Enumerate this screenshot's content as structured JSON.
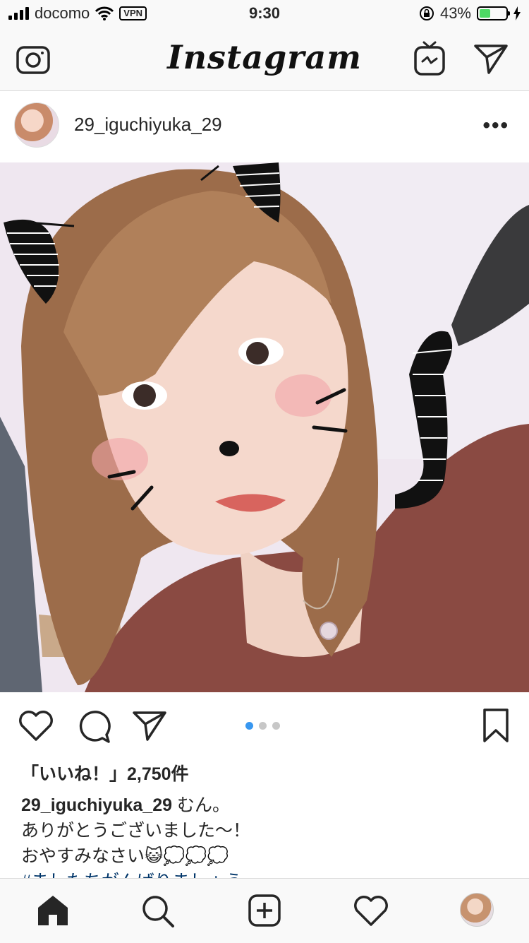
{
  "status_bar": {
    "carrier": "docomo",
    "vpn": "VPN",
    "time": "9:30",
    "battery_text": "43%",
    "battery_level": 0.43
  },
  "header": {
    "logo": "Instagram",
    "icons": [
      "camera-icon",
      "igtv-icon",
      "direct-message-icon"
    ]
  },
  "post": {
    "username": "29_iguchiyuka_29",
    "more_label": "•••",
    "carousel": {
      "count": 3,
      "active_index": 0
    },
    "likes_text": "「いいね！」2,750件",
    "caption": {
      "username": "29_iguchiyuka_29",
      "line1": "むん。",
      "line2": "ありがとうございました〜！",
      "line3": "おやすみなさい😺💭💭💭",
      "hashtags": "#ましたちがんばりましょう"
    }
  },
  "tab_bar": {
    "icons": [
      "home-icon",
      "search-icon",
      "new-post-icon",
      "activity-icon",
      "profile-avatar"
    ]
  },
  "colors": {
    "accent": "#3897f0",
    "text": "#262626",
    "battery": "#4cd964",
    "hashtag": "#003569"
  }
}
